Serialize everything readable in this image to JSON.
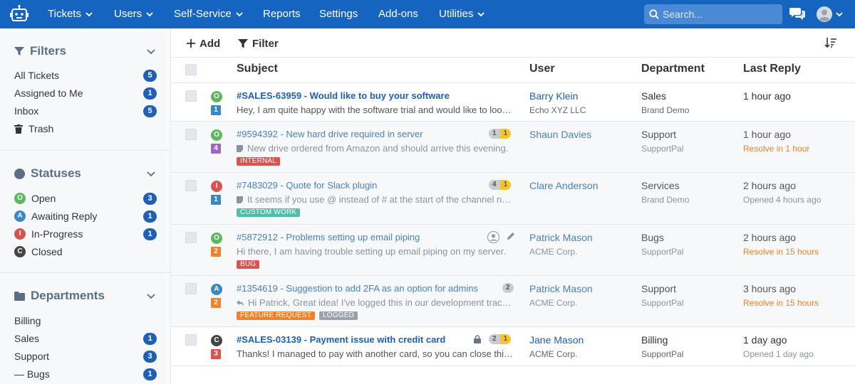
{
  "nav": {
    "items": [
      {
        "label": "Tickets",
        "dropdown": true
      },
      {
        "label": "Users",
        "dropdown": true
      },
      {
        "label": "Self-Service",
        "dropdown": true
      },
      {
        "label": "Reports",
        "dropdown": false
      },
      {
        "label": "Settings",
        "dropdown": false
      },
      {
        "label": "Add-ons",
        "dropdown": false
      },
      {
        "label": "Utilities",
        "dropdown": true
      }
    ],
    "search_placeholder": "Search...",
    "accent": "#1565c0"
  },
  "sidebar": {
    "filters": {
      "title": "Filters",
      "items": [
        {
          "label": "All Tickets",
          "count": "5"
        },
        {
          "label": "Assigned to Me",
          "count": "1"
        },
        {
          "label": "Inbox",
          "count": "5"
        },
        {
          "label": "Trash",
          "count": ""
        }
      ]
    },
    "statuses": {
      "title": "Statuses",
      "items": [
        {
          "label": "Open",
          "letter": "O",
          "color": "#5cb85c",
          "count": "3"
        },
        {
          "label": "Awaiting Reply",
          "letter": "A",
          "color": "#3a87c8",
          "count": "1"
        },
        {
          "label": "In-Progress",
          "letter": "I",
          "color": "#d9534f",
          "count": "1"
        },
        {
          "label": "Closed",
          "letter": "C",
          "color": "#444444",
          "count": ""
        }
      ]
    },
    "departments": {
      "title": "Departments",
      "items": [
        {
          "label": "Billing",
          "count": ""
        },
        {
          "label": "Sales",
          "count": "1"
        },
        {
          "label": "Support",
          "count": "3"
        },
        {
          "label": "— Bugs",
          "count": "1"
        }
      ]
    }
  },
  "toolbar": {
    "add_label": "Add",
    "filter_label": "Filter"
  },
  "table": {
    "columns": [
      "Subject",
      "User",
      "Department",
      "Last Reply"
    ],
    "rows": [
      {
        "read": false,
        "status_letter": "O",
        "status_color": "#5cb85c",
        "priority": "1",
        "priority_color": "#3a87c8",
        "subject": "#SALES-63959 - Would like to buy your software",
        "excerpt": "Hey, I am quite happy with the software trial and would like to look in...",
        "excerpt_icon": "",
        "tags": [],
        "msg_a": "",
        "msg_b": "",
        "extra_icons": [],
        "user": "Barry Klein",
        "org": "Echo XYZ LLC",
        "department": "Sales",
        "brand": "Brand Demo",
        "last_reply": "1 hour ago",
        "sla": "",
        "sla_warn": false
      },
      {
        "read": true,
        "status_letter": "O",
        "status_color": "#5cb85c",
        "priority": "4",
        "priority_color": "#a066c4",
        "subject": "#9594392 - New hard drive required in server",
        "excerpt": "New drive ordered from Amazon and should arrive this evening.",
        "excerpt_icon": "note-icon",
        "tags": [
          {
            "label": "INTERNAL",
            "color": "#d9534f"
          }
        ],
        "msg_a": "1",
        "msg_b": "1",
        "extra_icons": [],
        "user": "Shaun Davies",
        "org": "",
        "department": "Support",
        "brand": "SupportPal",
        "last_reply": "1 hour ago",
        "sla": "Resolve in 1 hour",
        "sla_warn": true
      },
      {
        "read": true,
        "status_letter": "I",
        "status_color": "#d9534f",
        "priority": "1",
        "priority_color": "#3a87c8",
        "subject": "#7483029 - Quote for Slack plugin",
        "excerpt": "It seems if you use @ instead of # at the start of the channel name",
        "excerpt_icon": "note-icon",
        "tags": [
          {
            "label": "CUSTOM WORK",
            "color": "#4fbfa8"
          }
        ],
        "msg_a": "4",
        "msg_b": "1",
        "extra_icons": [],
        "user": "Clare Anderson",
        "org": "",
        "department": "Services",
        "brand": "Brand Demo",
        "last_reply": "2 hours ago",
        "sla": "Opened 4 hours ago",
        "sla_warn": false
      },
      {
        "read": true,
        "status_letter": "O",
        "status_color": "#5cb85c",
        "priority": "2",
        "priority_color": "#f0812d",
        "subject": "#5872912 - Problems setting up email piping",
        "excerpt": "Hi there, I am having trouble setting up email piping on my server.",
        "excerpt_icon": "",
        "tags": [
          {
            "label": "BUG",
            "color": "#d9534f"
          }
        ],
        "msg_a": "",
        "msg_b": "",
        "extra_icons": [
          "user-icon",
          "pencil-icon"
        ],
        "user": "Patrick Mason",
        "org": "ACME Corp.",
        "department": "Bugs",
        "brand": "SupportPal",
        "last_reply": "2 hours ago",
        "sla": "Resolve in 15 hours",
        "sla_warn": true
      },
      {
        "read": true,
        "status_letter": "A",
        "status_color": "#3a87c8",
        "priority": "2",
        "priority_color": "#f0812d",
        "subject": "#1354619 - Suggestion to add 2FA as an option for admins",
        "excerpt": "Hi Patrick, Great idea! I've logged this in our development tracker.",
        "excerpt_icon": "reply-icon",
        "tags": [
          {
            "label": "FEATURE REQUEST",
            "color": "#f0812d"
          },
          {
            "label": "LOGGED",
            "color": "#9aa1a8"
          }
        ],
        "msg_a": "2",
        "msg_b": "",
        "extra_icons": [],
        "user": "Patrick Mason",
        "org": "ACME Corp.",
        "department": "Support",
        "brand": "SupportPal",
        "last_reply": "3 hours ago",
        "sla": "Resolve in 15 hours",
        "sla_warn": true
      },
      {
        "read": false,
        "status_letter": "C",
        "status_color": "#444444",
        "priority": "3",
        "priority_color": "#d9534f",
        "subject": "#SALES-03139 - Payment issue with credit card",
        "excerpt": "Thanks! I managed to pay with another card, so you can close this ticket.",
        "excerpt_icon": "",
        "tags": [],
        "msg_a": "2",
        "msg_b": "1",
        "extra_icons": [
          "lock-icon"
        ],
        "user": "Jane Mason",
        "org": "ACME Corp.",
        "department": "Billing",
        "brand": "SupportPal",
        "last_reply": "1 day ago",
        "sla": "Opened 1 day ago",
        "sla_warn": false
      }
    ]
  }
}
